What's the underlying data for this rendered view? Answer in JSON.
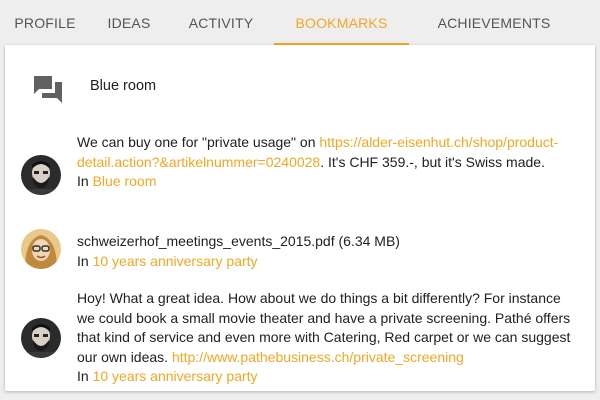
{
  "tabs": [
    {
      "label": "PROFILE"
    },
    {
      "label": "IDEAS"
    },
    {
      "label": "ACTIVITY"
    },
    {
      "label": "BOOKMARKS",
      "active": true
    },
    {
      "label": "ACHIEVEMENTS"
    }
  ],
  "accent_color": "#f5a623",
  "room": {
    "icon": "forum-icon",
    "title": "Blue room"
  },
  "entries": [
    {
      "text_before": "We can buy one for \"private usage\" on ",
      "link": "https://alder-eisenhut.ch/shop/product-detail.action?&artikelnummer=0240028",
      "text_after": ". It's CHF 359.-, but it's Swiss made.",
      "in_label": "In ",
      "in_link": "Blue room"
    },
    {
      "text_before": "schweizerhof_meetings_events_2015.pdf (6.34 MB)",
      "in_label": "In ",
      "in_link": "10 years anniversary party"
    },
    {
      "text_before": "Hoy! What a great idea. How about we do things a bit differently? For instance we could book a small movie theater and have a private screening. Pathé offers that kind of service and even more with Catering, Red carpet or we can suggest our own ideas. ",
      "link": "http://www.pathebusiness.ch/private_screening",
      "in_label": "In ",
      "in_link": "10 years anniversary party"
    }
  ]
}
